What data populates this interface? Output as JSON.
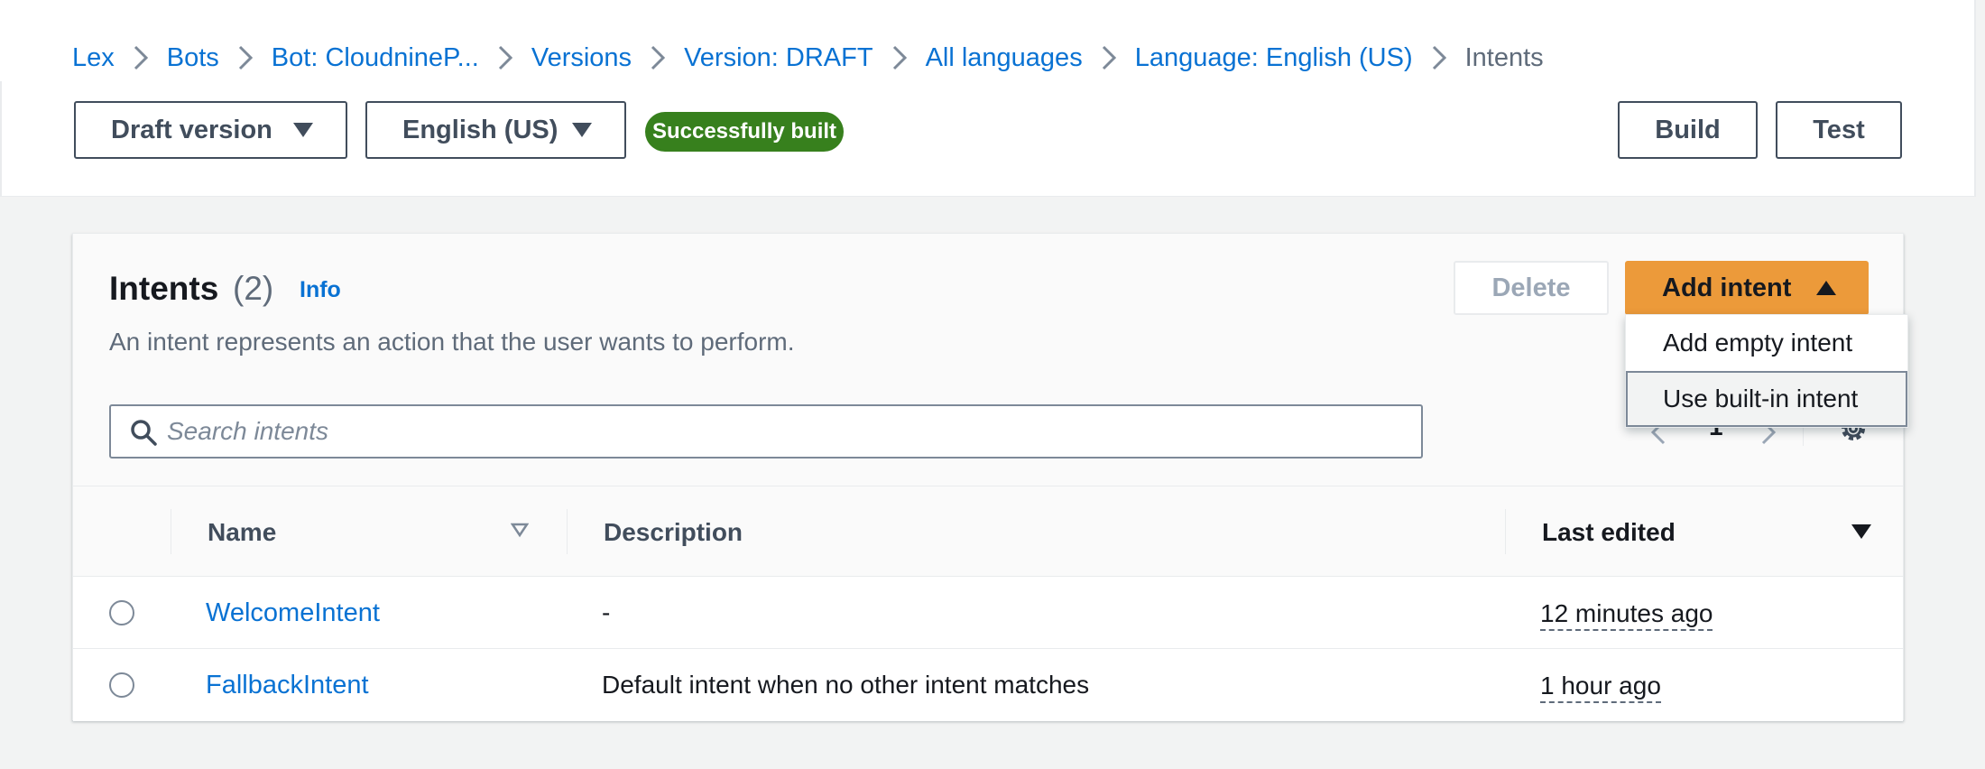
{
  "breadcrumb": {
    "items": [
      "Lex",
      "Bots",
      "Bot: CloudnineP...",
      "Versions",
      "Version: DRAFT",
      "All languages",
      "Language: English (US)"
    ],
    "current": "Intents"
  },
  "toolbar": {
    "version_select": "Draft version",
    "language_select": "English (US)",
    "status_badge": "Successfully built",
    "build_label": "Build",
    "test_label": "Test"
  },
  "panel": {
    "title": "Intents",
    "count": "(2)",
    "info": "Info",
    "description": "An intent represents an action that the user wants to perform.",
    "delete_label": "Delete",
    "add_label": "Add intent",
    "search_placeholder": "Search intents",
    "page": "1"
  },
  "dropdown": {
    "items": [
      "Add empty intent",
      "Use built-in intent"
    ],
    "highlighted_index": 1
  },
  "table": {
    "headers": {
      "name": "Name",
      "description": "Description",
      "last_edited": "Last edited"
    },
    "rows": [
      {
        "name": "WelcomeIntent",
        "description": "-",
        "last_edited": "12 minutes ago"
      },
      {
        "name": "FallbackIntent",
        "description": "Default intent when no other intent matches",
        "last_edited": "1 hour ago"
      }
    ]
  },
  "colors": {
    "link": "#0972d3",
    "primary_button": "#ec9a3a",
    "success_badge": "#37801d"
  },
  "icons": [
    "chevron-right-icon",
    "caret-down-icon",
    "caret-up-icon",
    "search-icon",
    "chevron-left-icon",
    "gear-icon",
    "sort-caret-icon"
  ]
}
